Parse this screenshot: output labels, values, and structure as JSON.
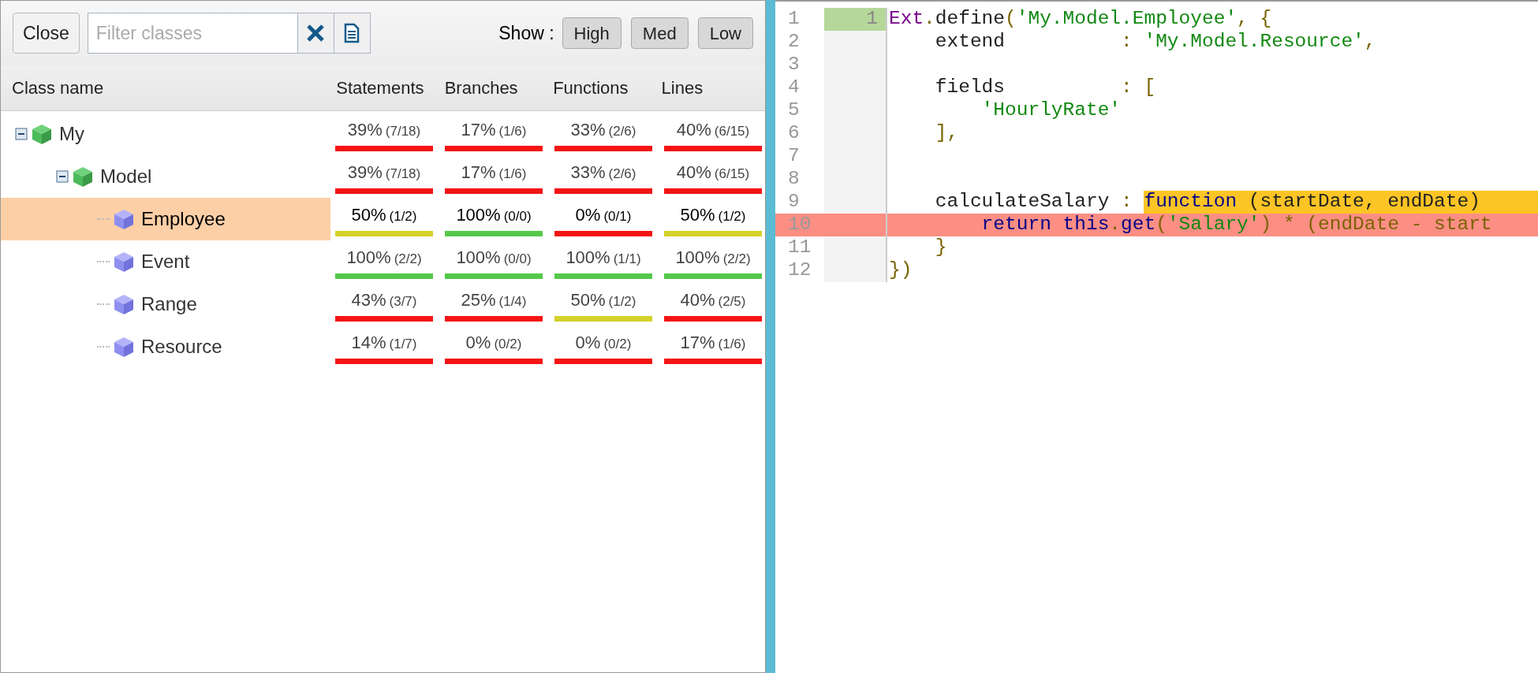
{
  "toolbar": {
    "close_button": "Close",
    "filter": {
      "placeholder": "Filter classes"
    },
    "show_label": "Show :",
    "show_buttons": [
      "High",
      "Med",
      "Low"
    ]
  },
  "table": {
    "columns": [
      "Class name",
      "Statements",
      "Branches",
      "Functions",
      "Lines"
    ],
    "rows": [
      {
        "name": "My",
        "kind": "package",
        "expanded": true,
        "selected": false,
        "metrics": [
          {
            "percent": "39%",
            "ratio": "(7/18)",
            "color": "#f41414"
          },
          {
            "percent": "17%",
            "ratio": "(1/6)",
            "color": "#f41414"
          },
          {
            "percent": "33%",
            "ratio": "(2/6)",
            "color": "#f41414"
          },
          {
            "percent": "40%",
            "ratio": "(6/15)",
            "color": "#f41414"
          }
        ],
        "children": [
          {
            "name": "Model",
            "kind": "package",
            "expanded": true,
            "selected": false,
            "metrics": [
              {
                "percent": "39%",
                "ratio": "(7/18)",
                "color": "#f41414"
              },
              {
                "percent": "17%",
                "ratio": "(1/6)",
                "color": "#f41414"
              },
              {
                "percent": "33%",
                "ratio": "(2/6)",
                "color": "#f41414"
              },
              {
                "percent": "40%",
                "ratio": "(6/15)",
                "color": "#f41414"
              }
            ],
            "children": [
              {
                "name": "Employee",
                "kind": "class",
                "selected": true,
                "metrics": [
                  {
                    "percent": "50%",
                    "ratio": "(1/2)",
                    "color": "#d4d12a"
                  },
                  {
                    "percent": "100%",
                    "ratio": "(0/0)",
                    "color": "#55c84a"
                  },
                  {
                    "percent": "0%",
                    "ratio": "(0/1)",
                    "color": "#f41414"
                  },
                  {
                    "percent": "50%",
                    "ratio": "(1/2)",
                    "color": "#d4d12a"
                  }
                ]
              },
              {
                "name": "Event",
                "kind": "class",
                "selected": false,
                "metrics": [
                  {
                    "percent": "100%",
                    "ratio": "(2/2)",
                    "color": "#55c84a"
                  },
                  {
                    "percent": "100%",
                    "ratio": "(0/0)",
                    "color": "#55c84a"
                  },
                  {
                    "percent": "100%",
                    "ratio": "(1/1)",
                    "color": "#55c84a"
                  },
                  {
                    "percent": "100%",
                    "ratio": "(2/2)",
                    "color": "#55c84a"
                  }
                ]
              },
              {
                "name": "Range",
                "kind": "class",
                "selected": false,
                "metrics": [
                  {
                    "percent": "43%",
                    "ratio": "(3/7)",
                    "color": "#f41414"
                  },
                  {
                    "percent": "25%",
                    "ratio": "(1/4)",
                    "color": "#f41414"
                  },
                  {
                    "percent": "50%",
                    "ratio": "(1/2)",
                    "color": "#d4d12a"
                  },
                  {
                    "percent": "40%",
                    "ratio": "(2/5)",
                    "color": "#f41414"
                  }
                ]
              },
              {
                "name": "Resource",
                "kind": "class",
                "selected": false,
                "metrics": [
                  {
                    "percent": "14%",
                    "ratio": "(1/7)",
                    "color": "#f41414"
                  },
                  {
                    "percent": "0%",
                    "ratio": "(0/2)",
                    "color": "#f41414"
                  },
                  {
                    "percent": "0%",
                    "ratio": "(0/2)",
                    "color": "#f41414"
                  },
                  {
                    "percent": "17%",
                    "ratio": "(1/6)",
                    "color": "#f41414"
                  }
                ]
              }
            ]
          }
        ]
      }
    ]
  },
  "code": {
    "lines": [
      {
        "number": "1",
        "hits": "1",
        "covered": true,
        "missed": false,
        "tokens": [
          {
            "kind": "variable",
            "text": "Ext"
          },
          {
            "kind": "punct",
            "text": "."
          },
          {
            "kind": "plain",
            "text": "define"
          },
          {
            "kind": "punct",
            "text": "("
          },
          {
            "kind": "string",
            "text": "'My.Model.Employee'"
          },
          {
            "kind": "punct",
            "text": ", {"
          }
        ]
      },
      {
        "number": "2",
        "covered": false,
        "missed": false,
        "tokens": [
          {
            "kind": "plain",
            "text": "    extend          "
          },
          {
            "kind": "punct",
            "text": ": "
          },
          {
            "kind": "string",
            "text": "'My.Model.Resource'"
          },
          {
            "kind": "punct",
            "text": ","
          }
        ]
      },
      {
        "number": "3",
        "covered": false,
        "missed": false
      },
      {
        "number": "4",
        "covered": false,
        "missed": false,
        "tokens": [
          {
            "kind": "plain",
            "text": "    fields          "
          },
          {
            "kind": "punct",
            "text": ": ["
          }
        ]
      },
      {
        "number": "5",
        "covered": false,
        "missed": false,
        "tokens": [
          {
            "kind": "string",
            "text": "        'HourlyRate'"
          }
        ]
      },
      {
        "number": "6",
        "covered": false,
        "missed": false,
        "tokens": [
          {
            "kind": "punct",
            "text": "    ],"
          }
        ]
      },
      {
        "number": "7",
        "covered": false,
        "missed": false
      },
      {
        "number": "8",
        "covered": false,
        "missed": false
      },
      {
        "number": "9",
        "covered": false,
        "missed": false,
        "tokens": [
          {
            "kind": "plain",
            "text": "    calculateSalary "
          },
          {
            "kind": "punct",
            "text": ": "
          },
          {
            "kind": "keyword",
            "text": "function",
            "partial": true
          },
          {
            "kind": "plain",
            "text": " (startDate, endDate)",
            "partial": true
          }
        ]
      },
      {
        "number": "10",
        "covered": false,
        "missed": true,
        "tokens": [
          {
            "kind": "keyword",
            "text": "        return "
          },
          {
            "kind": "keyword",
            "text": "this"
          },
          {
            "kind": "punct",
            "text": "."
          },
          {
            "kind": "keyword",
            "text": "get"
          },
          {
            "kind": "punct",
            "text": "("
          },
          {
            "kind": "string",
            "text": "'Salary'"
          },
          {
            "kind": "punct",
            "text": ") * (endDate - start"
          }
        ]
      },
      {
        "number": "11",
        "covered": false,
        "missed": false,
        "tokens": [
          {
            "kind": "punct",
            "text": "    }"
          }
        ]
      },
      {
        "number": "12",
        "covered": false,
        "missed": false,
        "tokens": [
          {
            "kind": "punct",
            "text": "})"
          }
        ]
      }
    ]
  }
}
